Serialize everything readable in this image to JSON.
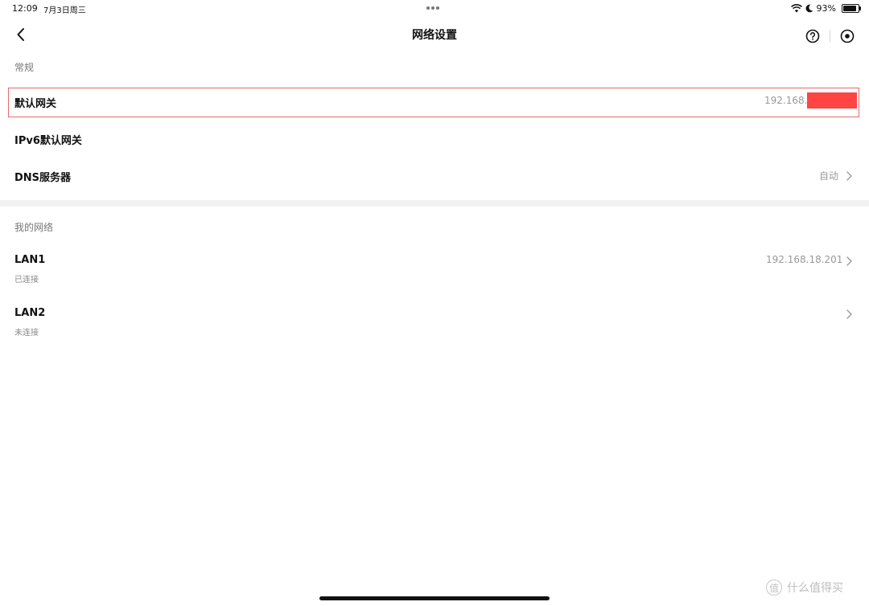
{
  "status_bar": {
    "time": "12:09",
    "date": "7月3日周三",
    "battery_percent": "93%",
    "battery_level": 0.93,
    "icons": [
      "wifi-icon",
      "moon-icon",
      "battery-icon"
    ]
  },
  "nav": {
    "title": "网络设置",
    "icons": [
      "back-icon",
      "help-icon",
      "record-icon"
    ]
  },
  "general_section": {
    "header": "常规",
    "rows": [
      {
        "label": "默认网关",
        "value": "192.168.",
        "value_redacted": true
      },
      {
        "label": "IPv6默认网关",
        "value": ""
      },
      {
        "label": "DNS服务器",
        "value": "自动"
      }
    ]
  },
  "my_network_section": {
    "header": "我的网络",
    "rows": [
      {
        "label": "LAN1",
        "sub": "已连接",
        "value": "192.168.18.201"
      },
      {
        "label": "LAN2",
        "sub": "未连接",
        "value": ""
      }
    ]
  },
  "watermark": {
    "logo_char": "值",
    "text": "什么值得买"
  },
  "colors": {
    "highlight_border": "#e86a6a",
    "redaction": "#ff4444",
    "section_gap": "#f2f2f2"
  }
}
